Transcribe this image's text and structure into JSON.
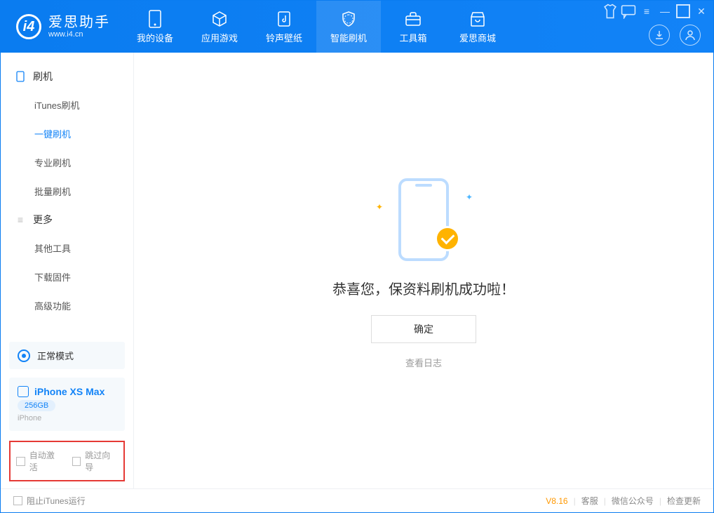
{
  "app": {
    "name_cn": "爱思助手",
    "name_en": "www.i4.cn"
  },
  "nav": {
    "items": [
      {
        "label": "我的设备"
      },
      {
        "label": "应用游戏"
      },
      {
        "label": "铃声壁纸"
      },
      {
        "label": "智能刷机"
      },
      {
        "label": "工具箱"
      },
      {
        "label": "爱思商城"
      }
    ]
  },
  "sidebar": {
    "group1_title": "刷机",
    "group1": [
      {
        "label": "iTunes刷机"
      },
      {
        "label": "一键刷机"
      },
      {
        "label": "专业刷机"
      },
      {
        "label": "批量刷机"
      }
    ],
    "group2_title": "更多",
    "group2": [
      {
        "label": "其他工具"
      },
      {
        "label": "下载固件"
      },
      {
        "label": "高级功能"
      }
    ]
  },
  "mode": {
    "label": "正常模式"
  },
  "device": {
    "name": "iPhone XS Max",
    "capacity": "256GB",
    "type": "iPhone"
  },
  "options": {
    "auto_activate": "自动激活",
    "skip_guide": "跳过向导"
  },
  "main": {
    "success_text": "恭喜您，保资料刷机成功啦！",
    "ok_button": "确定",
    "view_log": "查看日志"
  },
  "status": {
    "block_itunes": "阻止iTunes运行",
    "version": "V8.16",
    "support": "客服",
    "wechat": "微信公众号",
    "check_update": "检查更新"
  }
}
